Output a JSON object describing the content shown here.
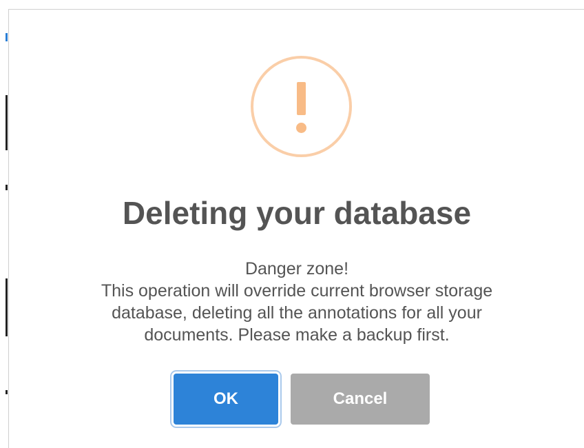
{
  "dialog": {
    "title": "Deleting your database",
    "content_lines": [
      "Danger zone!",
      "This operation will override current browser storage",
      "database, deleting all the annotations for all your",
      "documents. Please make a backup first."
    ],
    "icon": "warning-icon",
    "buttons": {
      "ok_label": "OK",
      "cancel_label": "Cancel"
    }
  },
  "colors": {
    "ok_button": "#2d83d8",
    "cancel_button": "#aaaaaa",
    "warning_ring": "#facea8",
    "warning_mark": "#f8bb86",
    "text": "#545454"
  }
}
